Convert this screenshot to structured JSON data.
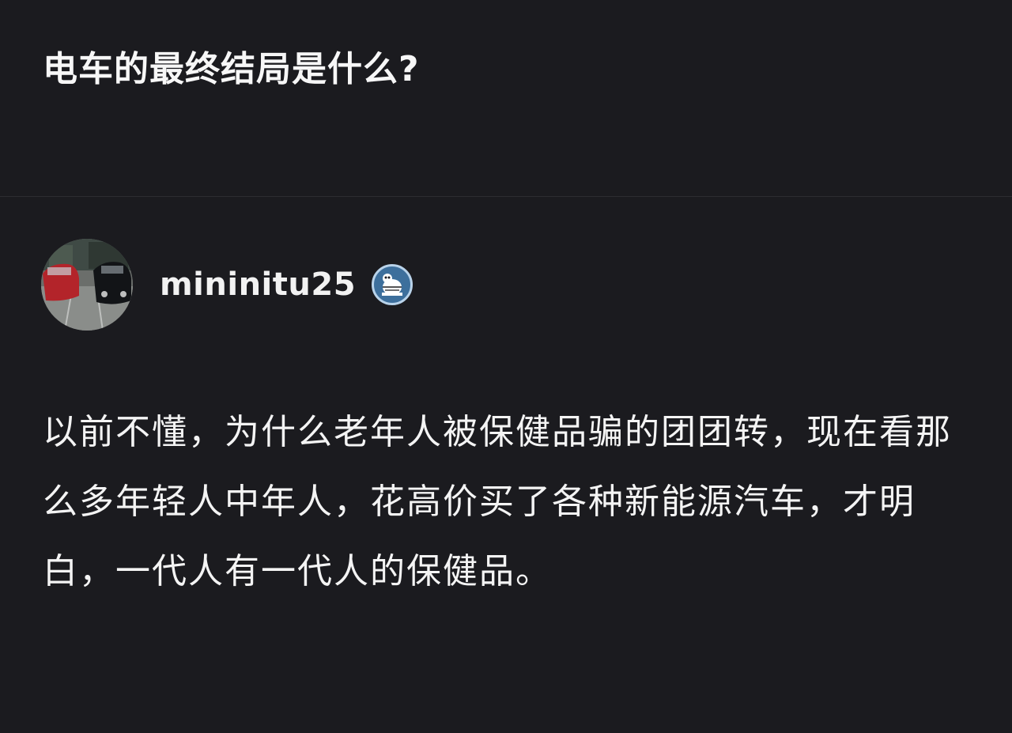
{
  "question": {
    "title": "电车的最终结局是什么?"
  },
  "answer": {
    "author": {
      "username": "mininitu25",
      "avatar_icon": "avatar-cars-photo",
      "badge_icon": "cartoon-badge-icon"
    },
    "text": " 以前不懂，为什么老年人被保健品骗的团团转，现在看那么多年轻人中年人，花高价买了各种新能源汽车，才明白，一代人有一代人的保健品。"
  },
  "colors": {
    "background": "#1b1b1f",
    "text": "#f4f4f4",
    "divider": "#2c2c31",
    "badge": "#3d6f9c"
  }
}
